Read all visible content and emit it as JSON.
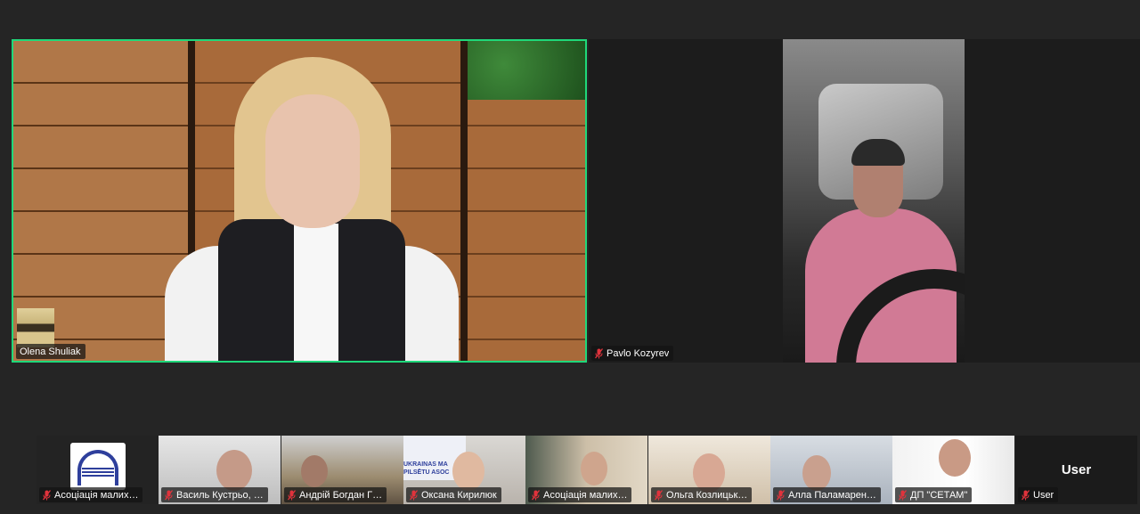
{
  "main_speaker": {
    "name": "Olena Shuliak",
    "active_speaker": true
  },
  "second_participant": {
    "name": "Pavlo Kozyrev",
    "muted": true
  },
  "thumbnails": [
    {
      "name": "Асоціація малих…",
      "muted": true
    },
    {
      "name": "Василь Кустрьо, …",
      "muted": true
    },
    {
      "name": "Андрій Богдан Г…",
      "muted": true
    },
    {
      "name": "Оксана Кирилюк",
      "muted": true
    },
    {
      "name": "Асоціація малих…",
      "muted": true
    },
    {
      "name": "Ольга Козлицьк…",
      "muted": true
    },
    {
      "name": "Алла Паламарен…",
      "muted": true
    },
    {
      "name": "ДП \"СЕТАМ\"",
      "muted": true
    },
    {
      "name": "User",
      "muted": true,
      "no_video_label": "User"
    }
  ],
  "sign_text": "UKRAINAS MA\nPILSĒTU ASOC",
  "colors": {
    "background": "#252525",
    "active_border": "#1fd87a",
    "muted_icon": "#e0333c"
  },
  "icons": {
    "muted": "mic-muted-icon"
  }
}
